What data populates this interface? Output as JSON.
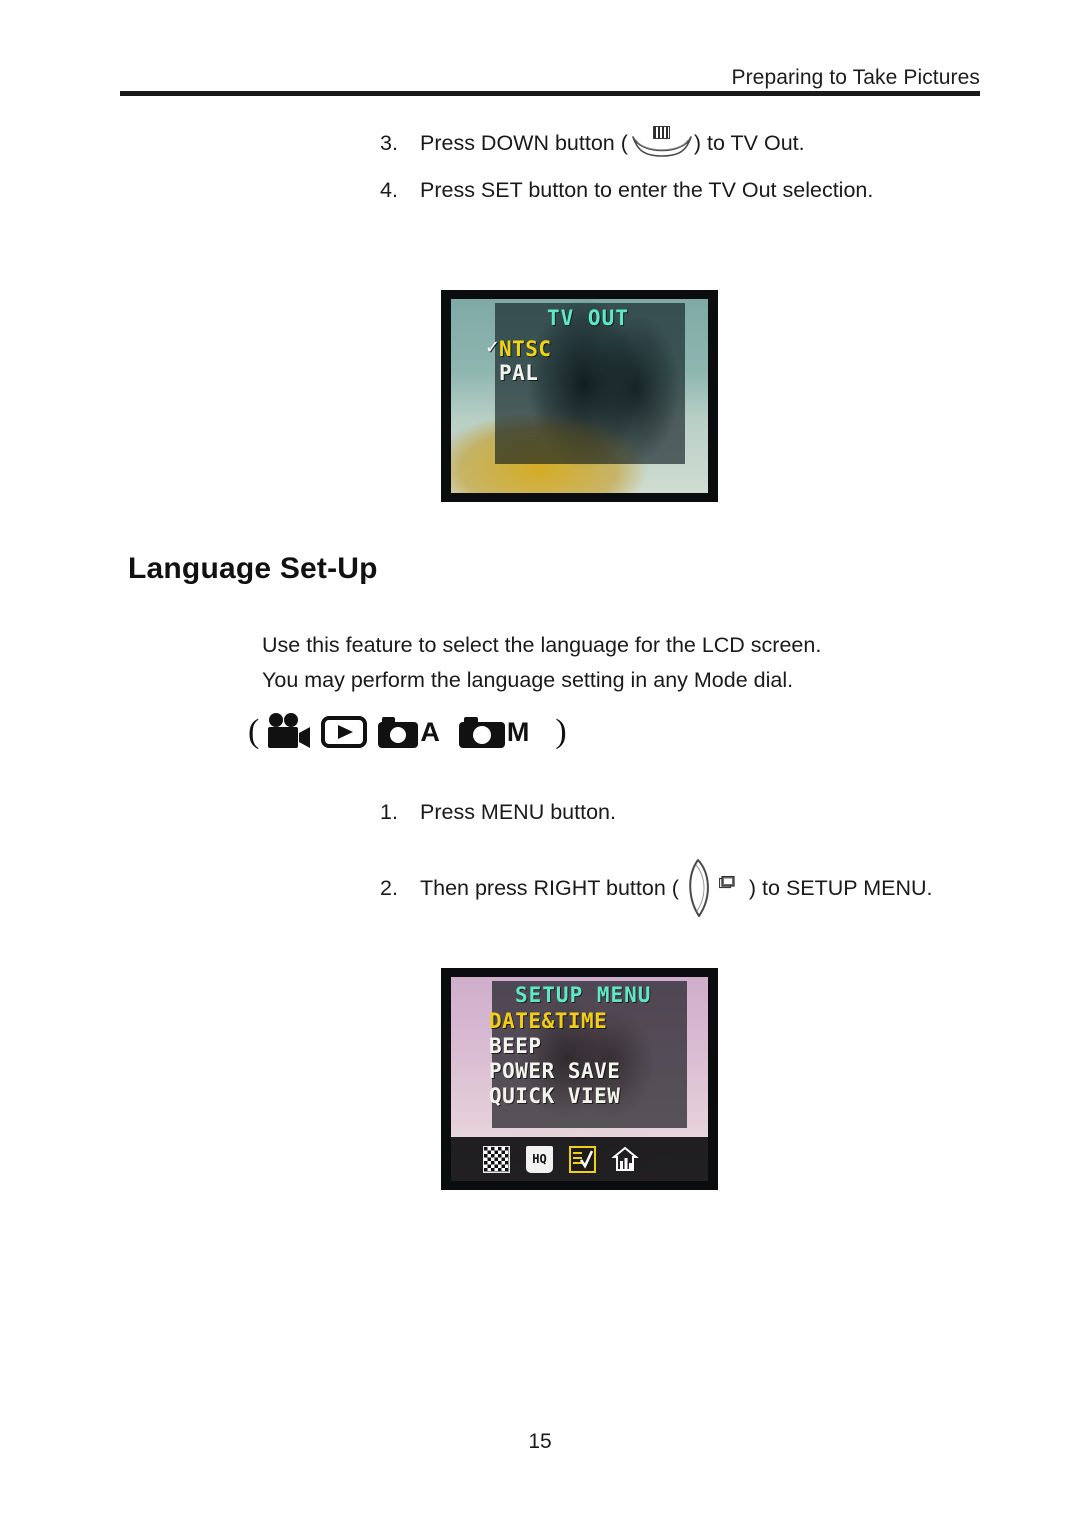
{
  "header": {
    "running_title": "Preparing to Take Pictures"
  },
  "steps_tv_out": [
    {
      "num": "3.",
      "text_before": "Press DOWN button (",
      "icon": "down-button-icon",
      "text_after": ") to TV Out."
    },
    {
      "num": "4.",
      "text_before": "Press SET button to enter the TV Out selection.",
      "icon": "",
      "text_after": ""
    }
  ],
  "lcd_tv_out": {
    "title": "TV OUT",
    "check_glyph": "✓",
    "items": [
      {
        "label": "NTSC",
        "selected": true,
        "color": "#f2d415"
      },
      {
        "label": "PAL",
        "selected": false,
        "color": "#f2f2ee"
      }
    ]
  },
  "section": {
    "heading": "Language Set-Up",
    "body_line1": "Use this feature to select the language for the LCD screen.",
    "body_line2": "You may perform the language setting in any Mode dial."
  },
  "mode_dial": {
    "paren_left": "(",
    "paren_right": ")",
    "icons": [
      {
        "name": "video-camera-mode-icon",
        "letter": ""
      },
      {
        "name": "playback-mode-icon",
        "letter": ""
      },
      {
        "name": "camera-auto-mode-icon",
        "letter": "A"
      },
      {
        "name": "camera-manual-mode-icon",
        "letter": "M"
      }
    ]
  },
  "steps_language": [
    {
      "num": "1.",
      "text_before": "Press MENU button.",
      "icon": "",
      "text_after": ""
    },
    {
      "num": "2.",
      "text_before": "Then press RIGHT button (",
      "icon": "right-button-icon",
      "text_after": ") to SETUP MENU."
    }
  ],
  "lcd_setup": {
    "title": "SETUP MENU",
    "items": [
      {
        "label": "DATE&TIME",
        "selected": true,
        "color": "#f2cf16"
      },
      {
        "label": "BEEP",
        "selected": false,
        "color": "#f4f4ef"
      },
      {
        "label": "POWER SAVE",
        "selected": false,
        "color": "#f4f4ef"
      },
      {
        "label": "QUICK VIEW",
        "selected": false,
        "color": "#f4f4ef"
      }
    ],
    "toolbar_icons": [
      {
        "name": "resolution-checkerboard-icon",
        "label": ""
      },
      {
        "name": "quality-hq-icon",
        "label": "HQ"
      },
      {
        "name": "setup-checklist-icon",
        "label": ""
      },
      {
        "name": "scene-mode-icon",
        "label": ""
      }
    ]
  },
  "footer": {
    "page_number": "15"
  },
  "colors": {
    "lcd_title": "#5fe8c8",
    "lcd_selected": "#f2cf16",
    "lcd_text": "#f4f4ef",
    "page_text": "#1a1a1a"
  }
}
